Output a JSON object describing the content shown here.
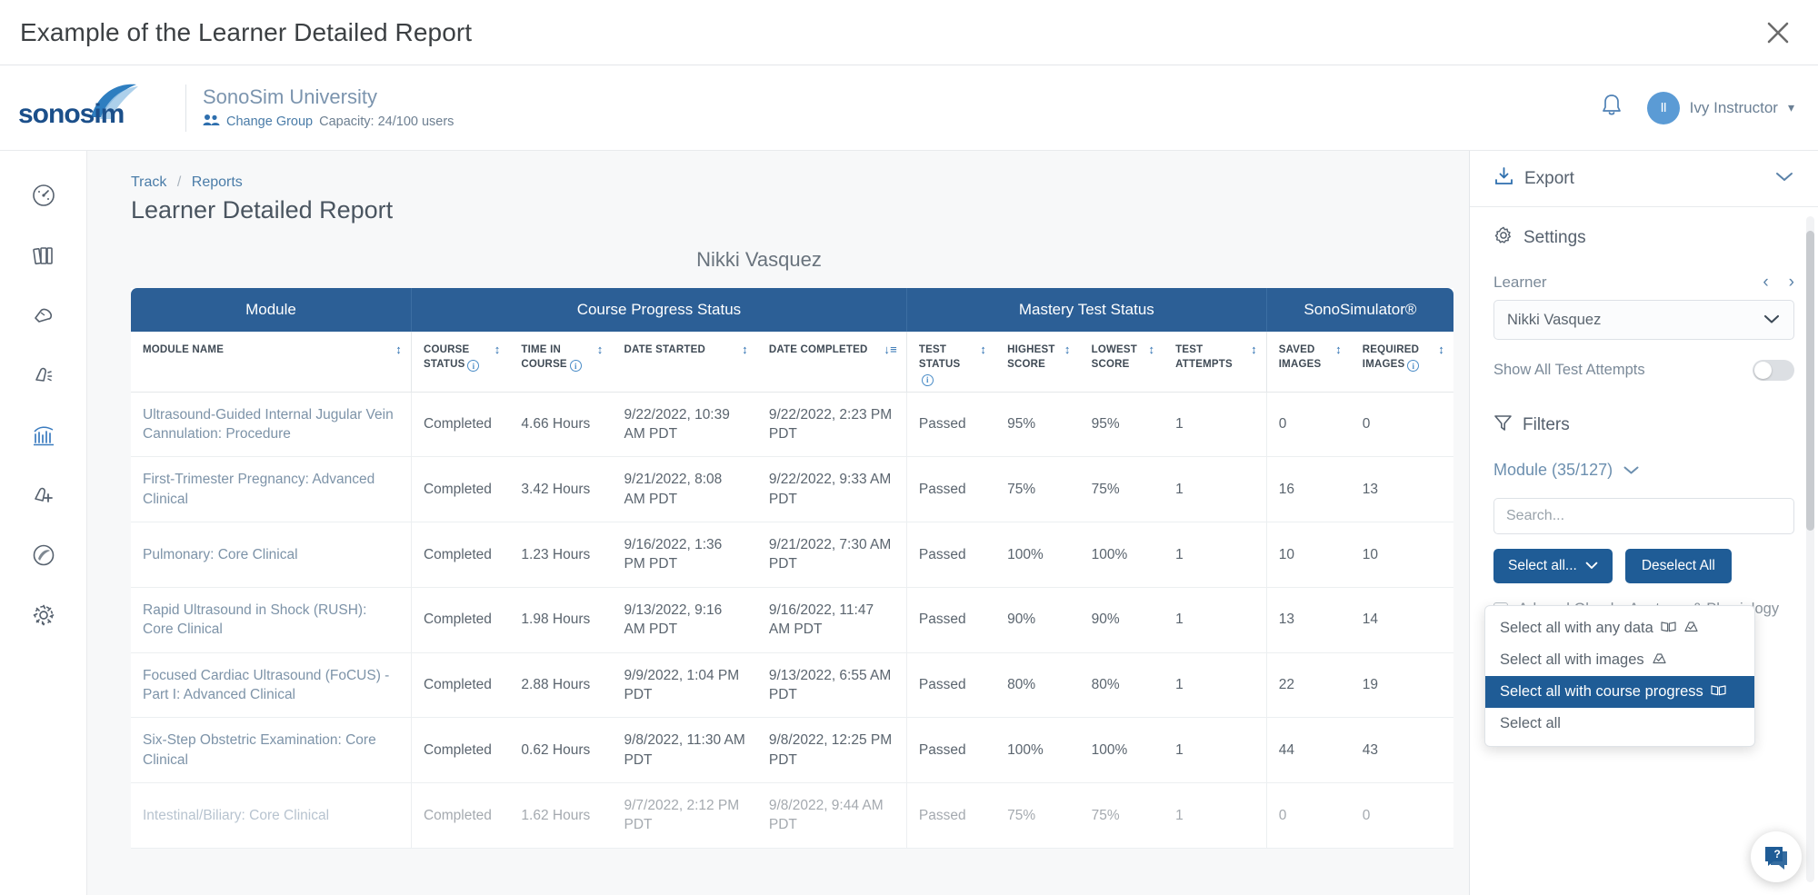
{
  "modal": {
    "title": "Example of the Learner Detailed Report",
    "close_icon": "close-icon"
  },
  "header": {
    "logo_text": "sonosim",
    "org_name": "SonoSim University",
    "change_group": "Change Group",
    "capacity": "Capacity: 24/100 users",
    "user_name": "Ivy Instructor",
    "avatar_initials": "II"
  },
  "rail": {
    "items": [
      {
        "name": "dashboard-icon",
        "label": "Dashboard",
        "active": false
      },
      {
        "name": "library-icon",
        "label": "Library",
        "active": false
      },
      {
        "name": "probe-icon",
        "label": "Probe",
        "active": false
      },
      {
        "name": "transducer-icon",
        "label": "Transducer",
        "active": false
      },
      {
        "name": "analytics-icon",
        "label": "Track",
        "active": true
      },
      {
        "name": "add-case-icon",
        "label": "Add Case",
        "active": false
      },
      {
        "name": "sonosim-icon",
        "label": "SonoSim",
        "active": false
      },
      {
        "name": "gear-icon",
        "label": "Settings",
        "active": false
      }
    ]
  },
  "breadcrumb": {
    "root": "Track",
    "sep": "/",
    "current": "Reports"
  },
  "page": {
    "title": "Learner Detailed Report",
    "learner_name": "Nikki Vasquez"
  },
  "table": {
    "groups": [
      {
        "label": "Module",
        "span": 1
      },
      {
        "label": "Course Progress Status",
        "span": 4
      },
      {
        "label": "Mastery Test Status",
        "span": 4
      },
      {
        "label": "SonoSimulator®",
        "span": 2
      }
    ],
    "columns": [
      {
        "label": "MODULE NAME",
        "info": false,
        "sort": "both"
      },
      {
        "label": "COURSE STATUS",
        "info": true,
        "sort": "both"
      },
      {
        "label": "TIME IN COURSE",
        "info": true,
        "sort": "both"
      },
      {
        "label": "DATE STARTED",
        "info": false,
        "sort": "both"
      },
      {
        "label": "DATE COMPLETED",
        "info": false,
        "sort": "desc"
      },
      {
        "label": "TEST STATUS",
        "info": true,
        "sort": "both"
      },
      {
        "label": "HIGHEST SCORE",
        "info": false,
        "sort": "both"
      },
      {
        "label": "LOWEST SCORE",
        "info": false,
        "sort": "both"
      },
      {
        "label": "TEST ATTEMPTS",
        "info": false,
        "sort": "both"
      },
      {
        "label": "SAVED IMAGES",
        "info": false,
        "sort": "both"
      },
      {
        "label": "REQUIRED IMAGES",
        "info": true,
        "sort": "both"
      }
    ],
    "rows": [
      {
        "module": "Ultrasound-Guided Internal Jugular Vein Cannulation: Procedure",
        "course_status": "Completed",
        "time_in_course": "4.66 Hours",
        "date_started": "9/22/2022, 10:39 AM PDT",
        "date_completed": "9/22/2022, 2:23 PM PDT",
        "test_status": "Passed",
        "highest_score": "95%",
        "lowest_score": "95%",
        "test_attempts": "1",
        "saved_images": "0",
        "required_images": "0"
      },
      {
        "module": "First-Trimester Pregnancy: Advanced Clinical",
        "course_status": "Completed",
        "time_in_course": "3.42 Hours",
        "date_started": "9/21/2022, 8:08 AM PDT",
        "date_completed": "9/22/2022, 9:33 AM PDT",
        "test_status": "Passed",
        "highest_score": "75%",
        "lowest_score": "75%",
        "test_attempts": "1",
        "saved_images": "16",
        "required_images": "13"
      },
      {
        "module": "Pulmonary: Core Clinical",
        "course_status": "Completed",
        "time_in_course": "1.23 Hours",
        "date_started": "9/16/2022, 1:36 PM PDT",
        "date_completed": "9/21/2022, 7:30 AM PDT",
        "test_status": "Passed",
        "highest_score": "100%",
        "lowest_score": "100%",
        "test_attempts": "1",
        "saved_images": "10",
        "required_images": "10"
      },
      {
        "module": "Rapid Ultrasound in Shock (RUSH): Core Clinical",
        "course_status": "Completed",
        "time_in_course": "1.98 Hours",
        "date_started": "9/13/2022, 9:16 AM PDT",
        "date_completed": "9/16/2022, 11:47 AM PDT",
        "test_status": "Passed",
        "highest_score": "90%",
        "lowest_score": "90%",
        "test_attempts": "1",
        "saved_images": "13",
        "required_images": "14"
      },
      {
        "module": "Focused Cardiac Ultrasound (FoCUS) - Part I: Advanced Clinical",
        "course_status": "Completed",
        "time_in_course": "2.88 Hours",
        "date_started": "9/9/2022, 1:04 PM PDT",
        "date_completed": "9/13/2022, 6:55 AM PDT",
        "test_status": "Passed",
        "highest_score": "80%",
        "lowest_score": "80%",
        "test_attempts": "1",
        "saved_images": "22",
        "required_images": "19"
      },
      {
        "module": "Six-Step Obstetric Examination: Core Clinical",
        "course_status": "Completed",
        "time_in_course": "0.62 Hours",
        "date_started": "9/8/2022, 11:30 AM PDT",
        "date_completed": "9/8/2022, 12:25 PM PDT",
        "test_status": "Passed",
        "highest_score": "100%",
        "lowest_score": "100%",
        "test_attempts": "1",
        "saved_images": "44",
        "required_images": "43"
      },
      {
        "module": "Intestinal/Biliary: Core Clinical",
        "course_status": "Completed",
        "time_in_course": "1.62 Hours",
        "date_started": "9/7/2022, 2:12 PM PDT",
        "date_completed": "9/8/2022, 9:44 AM PDT",
        "test_status": "Passed",
        "highest_score": "75%",
        "lowest_score": "75%",
        "test_attempts": "1",
        "saved_images": "0",
        "required_images": "0"
      }
    ]
  },
  "panel": {
    "export_label": "Export",
    "settings_label": "Settings",
    "learner_label": "Learner",
    "learner_value": "Nikki Vasquez",
    "show_all_test_attempts": "Show All Test Attempts",
    "toggle_on": false,
    "filters_label": "Filters",
    "module_filter_label": "Module (35/127)",
    "search_placeholder": "Search...",
    "select_all_btn": "Select all...",
    "deselect_all_btn": "Deselect All",
    "dropdown": {
      "items": [
        {
          "label": "Select all with any data",
          "icons": [
            "book-icon",
            "probe-icon"
          ],
          "selected": false
        },
        {
          "label": "Select all with images",
          "icons": [
            "probe-icon"
          ],
          "selected": false
        },
        {
          "label": "Select all with course progress",
          "icons": [
            "book-icon"
          ],
          "selected": true
        },
        {
          "label": "Select all",
          "icons": [],
          "selected": false
        }
      ]
    },
    "checkbox_items": [
      {
        "label": "Adrenal Glands: Anatomy & Physiology",
        "checked": false
      }
    ]
  },
  "help": {
    "icon": "help-icon"
  },
  "colors": {
    "header_blue": "#2c5f96",
    "button_blue": "#1f5c96",
    "accent_link": "#4a7ca8",
    "muted_text": "#7b8a99"
  }
}
